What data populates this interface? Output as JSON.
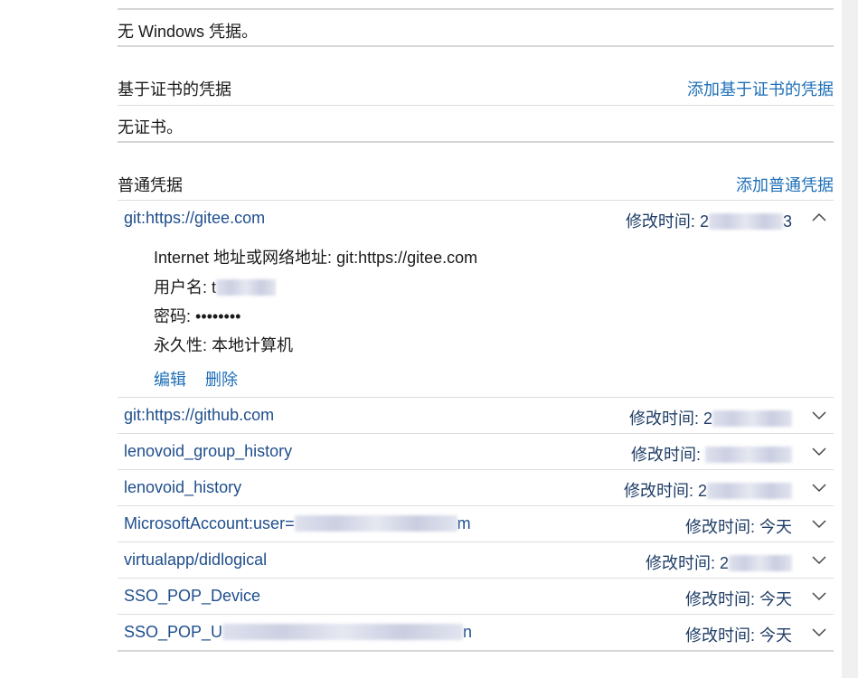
{
  "windows_creds": {
    "empty_text": "无 Windows 凭据。"
  },
  "cert_creds": {
    "title": "基于证书的凭据",
    "add_label": "添加基于证书的凭据",
    "empty_text": "无证书。"
  },
  "generic_creds": {
    "title": "普通凭据",
    "add_label": "添加普通凭据",
    "mod_label": "修改时间:",
    "expanded": {
      "name": "git:https://gitee.com",
      "mod_prefix": "2",
      "mod_suffix": "3",
      "address_label": "Internet 地址或网络地址:",
      "address_value": "git:https://gitee.com",
      "username_label": "用户名:",
      "username_prefix": "t",
      "password_label": "密码:",
      "password_value": "••••••••",
      "persistence_label": "永久性:",
      "persistence_value": "本地计算机",
      "edit_label": "编辑",
      "delete_label": "删除"
    },
    "items": [
      {
        "name": "git:https://github.com",
        "mod_prefix": "2",
        "mod_value": ""
      },
      {
        "name": "lenovoid_group_history",
        "mod_prefix": "",
        "mod_value": ""
      },
      {
        "name": "lenovoid_history",
        "mod_prefix": "2",
        "mod_value": ""
      },
      {
        "name_prefix": "MicrosoftAccount:user=",
        "name_suffix": "m",
        "mod_value": "今天"
      },
      {
        "name": "virtualapp/didlogical",
        "mod_prefix": "2",
        "mod_value": ""
      },
      {
        "name": "SSO_POP_Device",
        "mod_value": "今天"
      },
      {
        "name_prefix": "SSO_POP_U",
        "name_suffix": "n",
        "mod_value": "今天"
      }
    ]
  }
}
